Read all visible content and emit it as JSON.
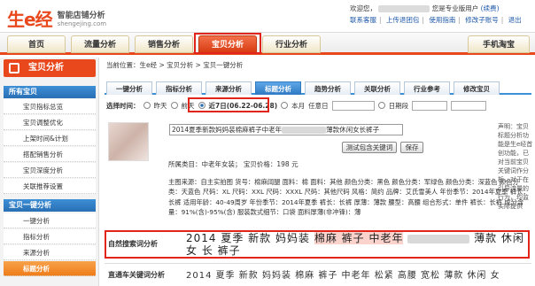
{
  "brand": {
    "name": "生e经",
    "slogan": "智能店铺分析",
    "domain": "shengejing.com"
  },
  "topbar": {
    "welcome": "欢迎您，",
    "user_suffix": "您是专业版用户",
    "upgrade": "(续费)",
    "links": [
      "联系客服",
      "上传退团包",
      "使用指南",
      "修改子账号",
      "退出"
    ]
  },
  "mainnav": [
    "首页",
    "流量分析",
    "销售分析",
    "宝贝分析",
    "行业分析",
    "手机淘宝"
  ],
  "mainnav_active": "宝贝分析",
  "sidebar": {
    "title": "宝贝分析",
    "groups": [
      {
        "label": "所有宝贝",
        "items": [
          "宝贝指标总览",
          "宝贝调整优化",
          "上架时间&计划",
          "搭配销售分析",
          "宝贝深度分析",
          "关联推荐设置"
        ]
      },
      {
        "label": "宝贝一键分析",
        "items": [
          "一键分析",
          "指标分析",
          "来源分析",
          "标题分析"
        ]
      }
    ],
    "active_item": "标题分析"
  },
  "breadcrumb": "当前位置：生e经 > 宝贝分析 > 宝贝一键分析",
  "tabs": [
    "一键分析",
    "指标分析",
    "来源分析",
    "标题分析",
    "趋势分析",
    "关联分析",
    "行业参考",
    "修改宝贝"
  ],
  "tabs_active": "标题分析",
  "timerow": {
    "label": "选择时间：",
    "options": [
      "昨天",
      "前天",
      "近7日(06.22-06.28)",
      "本月"
    ],
    "selected": "近7日(06.22-06.28)",
    "any_day": "任意日",
    "range": "日期段"
  },
  "product": {
    "title_prefix": "2014夏季新款妈妈装棉麻裤子中老年",
    "title_suffix": "薄款休闲女长裤子",
    "test_button": "测试包含关键词",
    "save_button": "保存",
    "category_line": "所属类目：中老年女装；    宝贝价格：198 元"
  },
  "attributes": "主图来源：自主实拍图 货号：棉麻阔腿 面料：棉 面料：其他 颜色分类：黑色 颜色分类：军绿色 颜色分类：深蓝色 颜色分类：天蓝色 尺码：XL 尺码：XXL 尺码：XXXL 尺码：其他尺码 风格：简约 品牌：艾氏雪美人 年份季节：2014年夏季 裤长：长裤 适用年龄：40-49周岁 年份季节：2014年夏季 裤长：长裤 厚薄：薄款 腰型：高腰 组合形式：单件 裤长：长裤 成分含量：91%(含)-95%(含) 服装款式细节：口袋 面料厚薄(非冲锋)：薄",
  "natural_search": {
    "label": "自然搜索词分析",
    "prefix": "2014 夏季 新款 妈妈装",
    "highlight": "棉麻 裤子 中老年",
    "suffix": "薄款 休闲 女 长 裤子"
  },
  "through_train": {
    "label": "直通车关键词分析",
    "value": "2014 夏季 新款 妈妈装 棉麻 裤子 中老年 松紧 高腰 宽松 薄款 休闲 女"
  },
  "sidenote": "声明：宝贝标题分析功能是生e经首创功能，已对当前宝贝关键词作分析，对于在引导流量的行为，均监实际提供"
}
